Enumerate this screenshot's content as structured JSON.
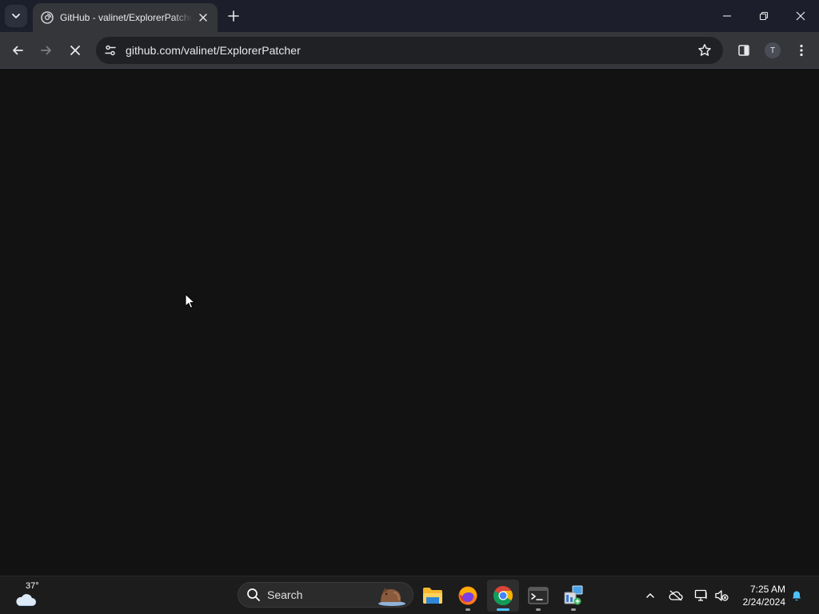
{
  "browser": {
    "tab": {
      "title": "GitHub - valinet/ExplorerPatcher",
      "favicon": "github-icon"
    },
    "omnibox": {
      "url": "github.com/valinet/ExplorerPatcher"
    },
    "profile_initial": "T",
    "toolbar_icons": [
      "back-icon",
      "forward-icon",
      "stop-icon",
      "site-info-icon",
      "bookmark-star-icon",
      "side-panel-icon",
      "menu-icon"
    ],
    "window_controls": [
      "minimize-icon",
      "restore-icon",
      "close-icon"
    ]
  },
  "taskbar": {
    "weather": {
      "temp": "37°",
      "icon": "cloud-icon"
    },
    "search": {
      "label": "Search"
    },
    "apps": [
      "file-explorer-icon",
      "firefox-icon",
      "chrome-icon",
      "terminal-icon",
      "task-manager-icon"
    ],
    "tray": [
      "chevron-up-icon",
      "onedrive-offline-icon",
      "network-icon",
      "volume-muted-icon",
      "notification-bell-icon"
    ],
    "clock": {
      "time": "7:25 AM",
      "date": "2/24/2024"
    }
  },
  "colors": {
    "tabstrip": "#1c1f2b",
    "toolbar": "#35363a",
    "omnibox": "#202124",
    "content": "#121212",
    "taskbar": "#1c1c1c",
    "accent": "#4cc2ff"
  }
}
